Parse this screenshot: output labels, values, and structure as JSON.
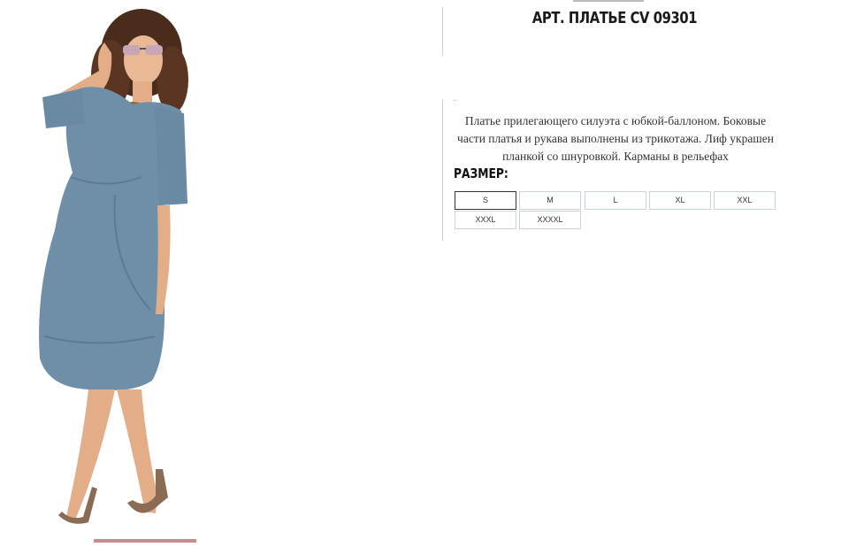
{
  "product": {
    "title": "АРТ. ПЛАТЬЕ CV 09301",
    "marker": "..",
    "description": "Платье прилегающего силуэта с юбкой-баллоном. Боковые части платья и рукава выполнены из трикотажа. Лиф украшен планкой со шнуровкой. Карманы в рельефах",
    "size_label": "РАЗМЕР:",
    "sizes": [
      "S",
      "M",
      "L",
      "XL",
      "XXL",
      "XXXL",
      "XXXXL"
    ],
    "selected_size": "S"
  },
  "colors": {
    "dress": "#6f8fa8",
    "accent_bar": "#c98a92"
  }
}
